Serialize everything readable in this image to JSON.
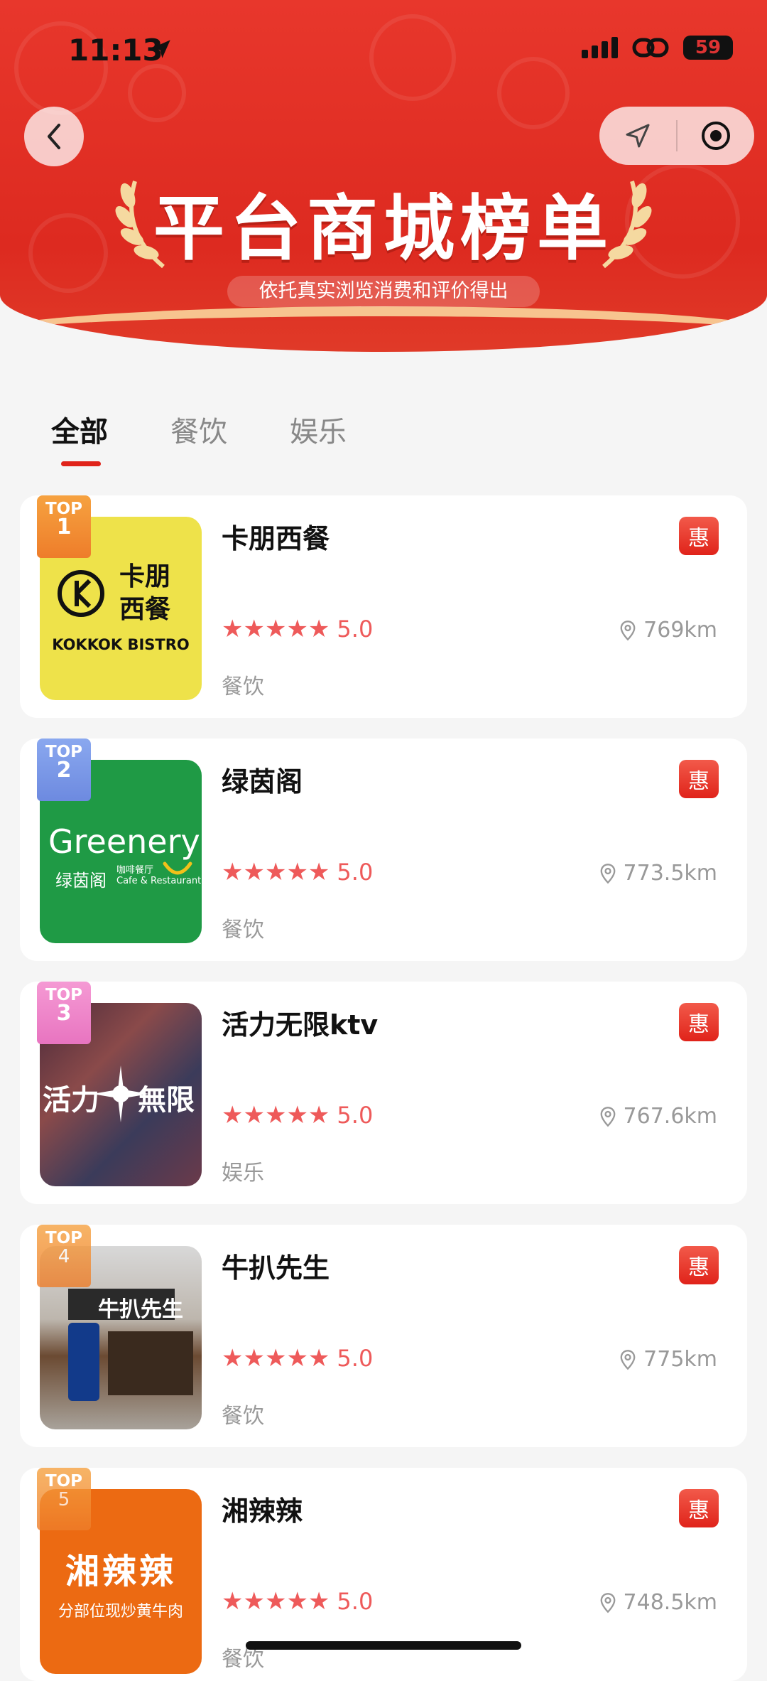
{
  "status_bar": {
    "time": "11:13",
    "battery": "59"
  },
  "hero": {
    "title": "平台商城榜单",
    "subtitle": "依托真实浏览消费和评价得出"
  },
  "tabs": [
    {
      "label": "全部",
      "active": true
    },
    {
      "label": "餐饮",
      "active": false
    },
    {
      "label": "娱乐",
      "active": false
    }
  ],
  "items": [
    {
      "rank_label": "TOP",
      "rank": "1",
      "name": "卡朋西餐",
      "rating": "5.0",
      "stars": 5,
      "distance": "769km",
      "category": "餐饮",
      "promo": "惠",
      "thumb": {
        "type": "logo",
        "line1": "卡朋",
        "line2": "西餐",
        "brand": "KOKKOK BISTRO",
        "mark": "K",
        "bg": "#eee24a"
      }
    },
    {
      "rank_label": "TOP",
      "rank": "2",
      "name": "绿茵阁",
      "rating": "5.0",
      "stars": 5,
      "distance": "773.5km",
      "category": "餐饮",
      "promo": "惠",
      "thumb": {
        "type": "greenery",
        "brand": "Greenery",
        "cn": "绿茵阁",
        "tag": "咖啡餐厅",
        "tag2": "Cafe & Restaurant",
        "bg": "#1f9a45"
      }
    },
    {
      "rank_label": "TOP",
      "rank": "3",
      "name": "活力无限ktv",
      "rating": "5.0",
      "stars": 5,
      "distance": "767.6km",
      "category": "娱乐",
      "promo": "惠",
      "thumb": {
        "type": "ktv",
        "text_left": "活力",
        "text_right": "無限"
      }
    },
    {
      "rank_label": "TOP",
      "rank": "4",
      "name": "牛扒先生",
      "rating": "5.0",
      "stars": 5,
      "distance": "775km",
      "category": "餐饮",
      "promo": "惠",
      "thumb": {
        "type": "storefront",
        "sign": "牛扒先生"
      }
    },
    {
      "rank_label": "TOP",
      "rank": "5",
      "name": "湘辣辣",
      "rating": "5.0",
      "stars": 5,
      "distance": "748.5km",
      "category": "餐饮",
      "promo": "惠",
      "thumb": {
        "type": "orange",
        "title": "湘辣辣",
        "sub": "分部位现炒黄牛肉",
        "bg": "#ec6a12"
      }
    }
  ],
  "colors": {
    "accent": "#e0231a",
    "star": "#ee5a5a",
    "hero": "#e8372c"
  },
  "icons": [
    "location-arrow-icon",
    "signal-icon",
    "link-icon",
    "battery-icon",
    "back-chevron-icon",
    "navigate-icon",
    "record-icon",
    "laurel-icon",
    "star-icon",
    "location-pin-icon"
  ]
}
